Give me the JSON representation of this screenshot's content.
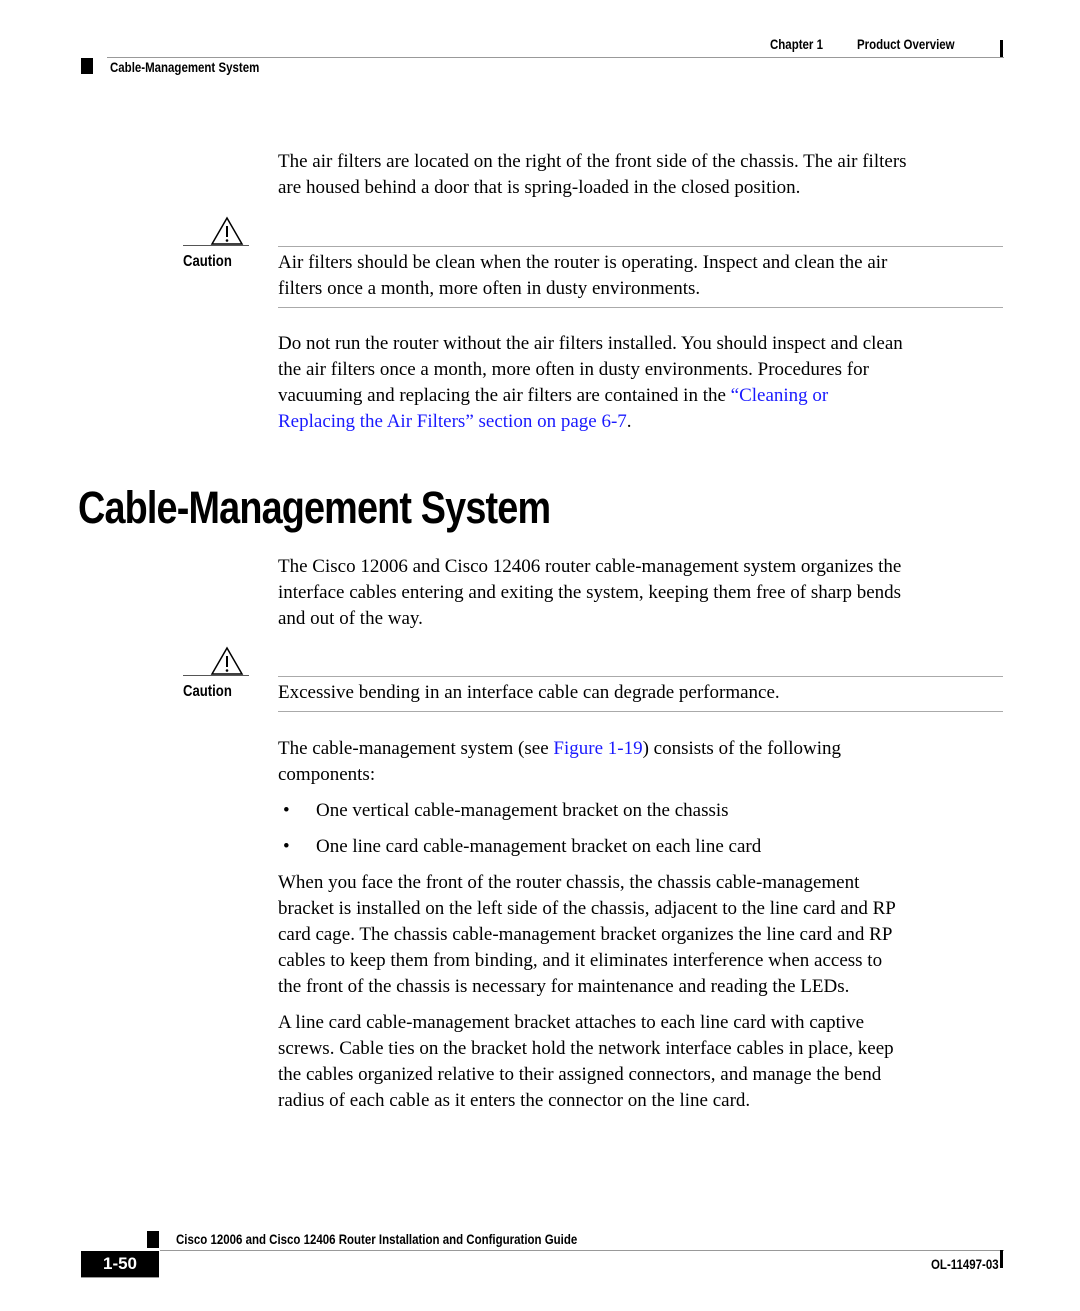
{
  "header": {
    "chapter": "Chapter 1",
    "chapter_title": "Product Overview",
    "section": "Cable-Management System"
  },
  "intro_paragraph": {
    "line1": "The air filters are located on the right of the front side of the chassis. The air filters",
    "line2": "are housed behind a door that is spring-loaded in the closed position."
  },
  "caution1": {
    "label": "Caution",
    "icon": "warning-triangle-icon",
    "line1": "Air filters should be clean when the router is operating. Inspect and clean the air",
    "line2": "filters once a month, more often in dusty environments."
  },
  "filters_paragraph": {
    "line1": "Do not run the router without the air filters installed. You should inspect and clean",
    "line2": "the air filters once a month, more often in dusty environments. Procedures for",
    "line3_text": "vacuuming and replacing the air filters are contained in the ",
    "line3_link": "“Cleaning or",
    "line4_link": "Replacing the Air Filters” section on page 6-7",
    "line4_end": "."
  },
  "section_heading": "Cable-Management System",
  "cable_intro": {
    "line1": "The Cisco 12006 and Cisco 12406 router cable-management system organizes the",
    "line2": "interface cables entering and exiting the system, keeping them free of sharp bends",
    "line3": "and out of the way."
  },
  "caution2": {
    "label": "Caution",
    "icon": "warning-triangle-icon",
    "text": "Excessive bending in an interface cable can degrade performance."
  },
  "components_paragraph": {
    "line1_before": "The cable-management system (see ",
    "line1_link": "Figure 1-19",
    "line1_after": ") consists of the following",
    "line2": "components:"
  },
  "bullets": [
    "One vertical cable-management bracket on the chassis",
    "One line card cable-management bracket on each line card"
  ],
  "chassis_paragraph": {
    "lines": [
      "When you face the front of the router chassis, the chassis cable-management",
      "bracket is installed on the left side of the chassis, adjacent to the line card and RP",
      "card cage. The chassis cable-management bracket organizes the line card and RP",
      "cables to keep them from binding, and it eliminates interference when access to",
      "the front of the chassis is necessary for maintenance and reading the LEDs."
    ]
  },
  "linecard_paragraph": {
    "lines": [
      "A line card cable-management bracket attaches to each line card with captive",
      "screws. Cable ties on the bracket hold the network interface cables in place, keep",
      "the cables organized relative to their assigned connectors, and manage the bend",
      "radius of each cable as it enters the connector on the line card."
    ]
  },
  "footer": {
    "guide_title": "Cisco 12006 and Cisco 12406 Router Installation and Configuration Guide",
    "page_number": "1-50",
    "doc_id": "OL-11497-03"
  },
  "colors": {
    "link": "#1a1aff",
    "text": "#000000",
    "rule": "#999999"
  }
}
